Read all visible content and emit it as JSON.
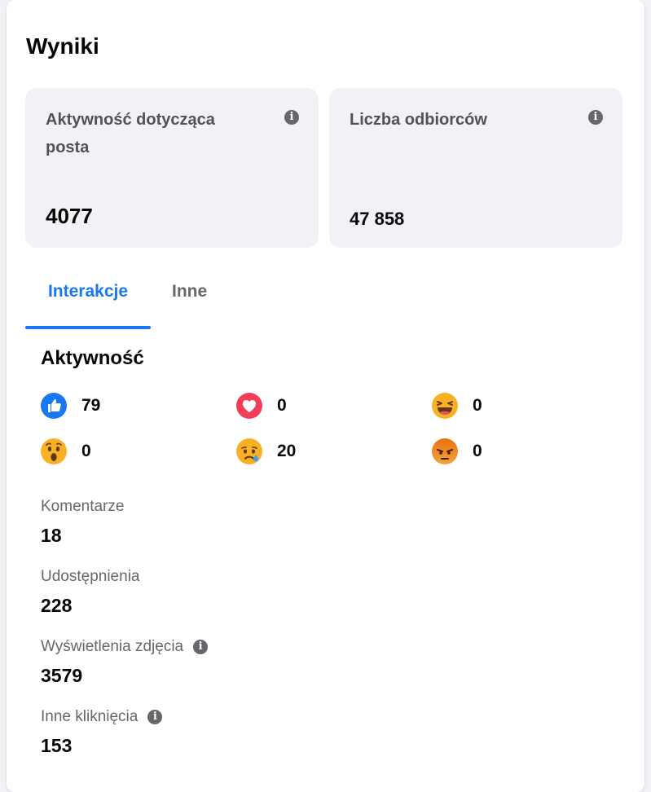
{
  "results": {
    "title": "Wyniki",
    "stats": [
      {
        "label": "Aktywność dotycząca posta",
        "value": "4077"
      },
      {
        "label": "Liczba odbiorców",
        "value": "47 858"
      }
    ],
    "tabs": [
      "Interakcje",
      "Inne"
    ],
    "active_tab": "Interakcje",
    "section_title": "Aktywność",
    "reactions": [
      {
        "icon": "like-icon",
        "count": "79"
      },
      {
        "icon": "love-icon",
        "count": "0"
      },
      {
        "icon": "haha-icon",
        "count": "0"
      },
      {
        "icon": "wow-icon",
        "count": "0"
      },
      {
        "icon": "sad-icon",
        "count": "20"
      },
      {
        "icon": "angry-icon",
        "count": "0"
      }
    ],
    "metrics": [
      {
        "label": "Komentarze",
        "value": "18"
      },
      {
        "label": "Udostępnienia",
        "value": "228"
      },
      {
        "label": "Wyświetlenia zdjęcia",
        "value": "3579"
      },
      {
        "label": "Inne kliknięcia",
        "value": "153"
      }
    ]
  },
  "colors": {
    "accent": "#1877f2",
    "secondary_text": "#65676b",
    "stat_bg": "#f0f2f5"
  }
}
